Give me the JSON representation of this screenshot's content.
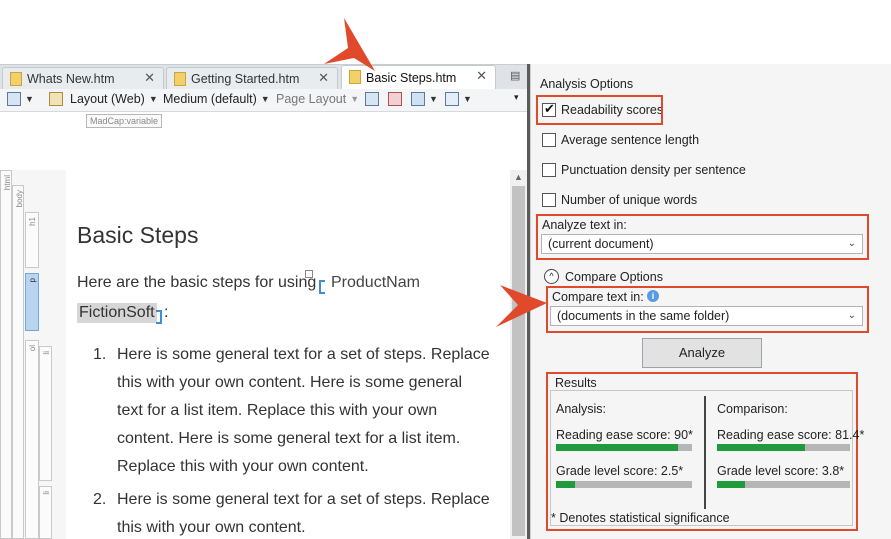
{
  "tabs": [
    {
      "label": "Whats New.htm",
      "close": "✕",
      "active": false
    },
    {
      "label": "Getting Started.htm",
      "close": "✕",
      "active": false
    },
    {
      "label": "Basic Steps.htm",
      "close": "✕",
      "active": true
    }
  ],
  "toolbar": {
    "layout": "Layout (Web)",
    "medium": "Medium (default)",
    "page_layout": "Page Layout"
  },
  "editor": {
    "variable_tag": "MadCap:variable",
    "structure_labels": {
      "html": "html",
      "body": "body",
      "h1": "h1",
      "p": "p",
      "ol": "ol",
      "li": "li"
    },
    "title": "Basic Steps",
    "intro": "Here are the basic steps for using",
    "product_variable": "ProductNam",
    "variable_value": "FictionSoft",
    "colon": ":",
    "list": [
      {
        "number": "1.",
        "lines": [
          "Here is some general text for a set of steps. Replace",
          "this with your own content. Here is some general",
          "text for a list item. Replace this with your own",
          "content. Here is some general text for a list item.",
          "Replace this with your own content."
        ]
      },
      {
        "number": "2.",
        "lines": [
          "Here is some general text for a set of steps. Replace",
          "this with your own content."
        ]
      }
    ]
  },
  "panel": {
    "section_title": "Analysis Options",
    "options": [
      {
        "label": "Readability scores",
        "checked": true
      },
      {
        "label": "Average sentence length",
        "checked": false
      },
      {
        "label": "Punctuation density per sentence",
        "checked": false
      },
      {
        "label": "Number of unique words",
        "checked": false
      }
    ],
    "analyze_in_label": "Analyze text in:",
    "analyze_in_value": "(current document)",
    "compare_options_label": "Compare Options",
    "compare_in_label": "Compare text in:",
    "compare_in_value": "(documents in the same folder)",
    "analyze_button": "Analyze",
    "results": {
      "title": "Results",
      "analysis_header": "Analysis:",
      "comparison_header": "Comparison:",
      "analysis": [
        {
          "label": "Reading ease score: 90*",
          "fraction": 0.9
        },
        {
          "label": "Grade level score: 2.5*",
          "fraction": 0.14
        }
      ],
      "comparison": [
        {
          "label": "Reading ease score: 81.4*",
          "fraction": 0.66
        },
        {
          "label": "Grade level score: 3.8*",
          "fraction": 0.21
        }
      ],
      "footnote": "* Denotes statistical significance"
    }
  },
  "colors": {
    "highlight": "#e04a2a",
    "bar_fill": "#1f9b3b",
    "bar_track": "#b6b6b6"
  },
  "icons": [
    "document-icon",
    "close-icon",
    "preview-icon",
    "conditions-icon",
    "show-tags-icon",
    "chevron-down-icon",
    "info-icon",
    "collapse-up-icon",
    "checkmark-icon",
    "callout-arrow"
  ]
}
